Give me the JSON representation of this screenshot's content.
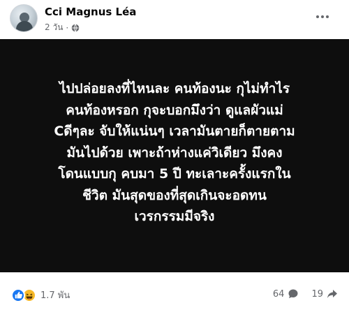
{
  "post": {
    "author": "Cci Magnus Léa",
    "time": "2 วัน",
    "separator": "·",
    "lines": [
      "ไปปล่อยลงที่ไหนละ คนท้องนะ กุไม่ทำไร",
      "คนท้องหรอก กุจะบอกมึงว่า ดูแลผัวแม่",
      "Cดีๆละ จับให้แน่นๆ เวลามันตายก็ตายตาม",
      "มันไปด้วย เพาะถ้าห่างแค่วิเดียว มึงคง",
      "โดนแบบกุ คบมา 5 ปี ทะเลาะครั้งแรกใน",
      "ชีวิต มันสุดของที่สุดเกินจะอดทน",
      "เวรกรรมมีจริง"
    ],
    "background_color": "#0e0e0e"
  },
  "footer": {
    "reaction_count": "1.7 พัน",
    "comment_count": "64",
    "share_count": "19"
  },
  "colors": {
    "like": "#1877f2",
    "haha": "#f7b928",
    "muted": "#65676b"
  }
}
